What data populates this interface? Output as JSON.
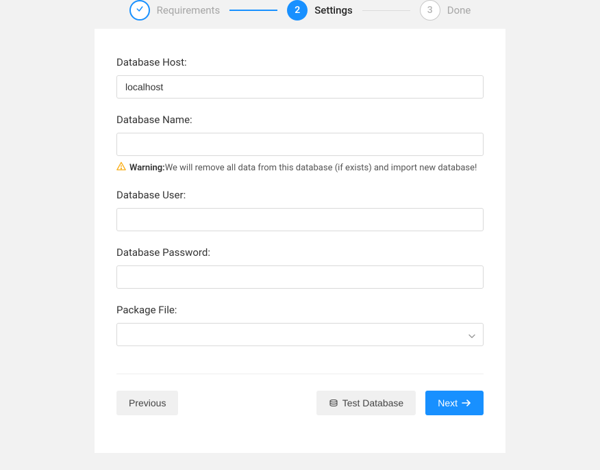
{
  "stepper": {
    "steps": [
      {
        "label": "Requirements",
        "state": "completed"
      },
      {
        "label": "Settings",
        "number": "2",
        "state": "active"
      },
      {
        "label": "Done",
        "number": "3",
        "state": "pending"
      }
    ]
  },
  "form": {
    "db_host": {
      "label": "Database Host:",
      "value": "localhost"
    },
    "db_name": {
      "label": "Database Name:",
      "value": "",
      "warning_label": "Warning:",
      "warning_text": "We will remove all data from this database (if exists) and import new database!"
    },
    "db_user": {
      "label": "Database User:",
      "value": ""
    },
    "db_password": {
      "label": "Database Password:",
      "value": ""
    },
    "package_file": {
      "label": "Package File:",
      "selected": ""
    }
  },
  "buttons": {
    "previous": "Previous",
    "test_database": "Test Database",
    "next": "Next"
  }
}
